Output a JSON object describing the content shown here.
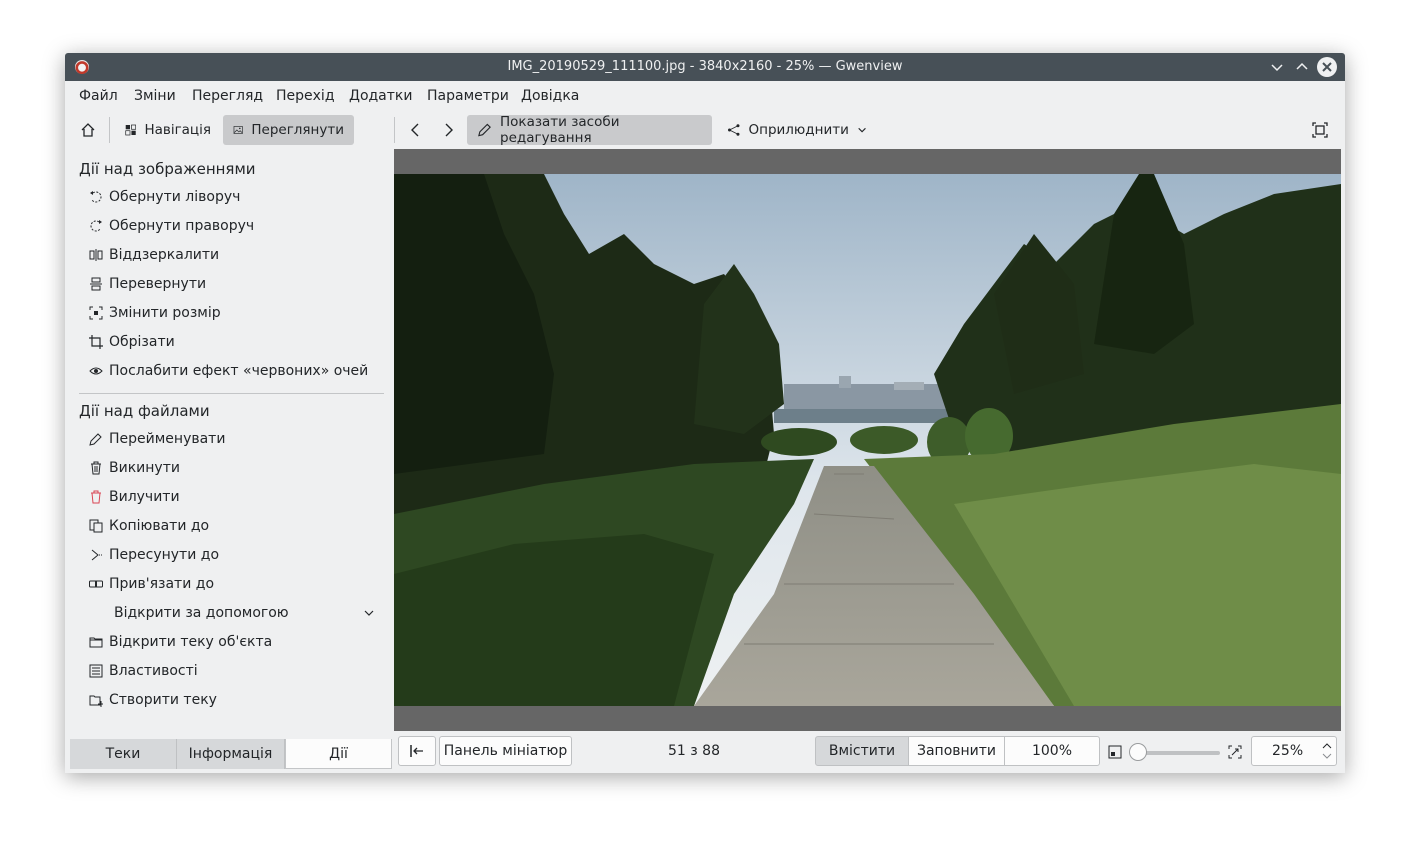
{
  "window": {
    "title": "IMG_20190529_111100.jpg - 3840x2160 - 25% — Gwenview"
  },
  "menu": [
    "Файл",
    "Зміни",
    "Перегляд",
    "Перехід",
    "Додатки",
    "Параметри",
    "Довідка"
  ],
  "toolbar": {
    "navigation": "Навігація",
    "view": "Переглянути",
    "edit_tools": "Показати засоби редагування",
    "share": "Оприлюднити"
  },
  "sidebar": {
    "image_actions_title": "Дії над зображеннями",
    "image_actions": [
      {
        "label": "Обернути ліворуч",
        "icon": "rotate-left-icon"
      },
      {
        "label": "Обернути праворуч",
        "icon": "rotate-right-icon"
      },
      {
        "label": "Віддзеркалити",
        "icon": "mirror-icon"
      },
      {
        "label": "Перевернути",
        "icon": "flip-icon"
      },
      {
        "label": "Змінити розмір",
        "icon": "resize-icon"
      },
      {
        "label": "Обрізати",
        "icon": "crop-icon"
      },
      {
        "label": "Послабити ефект «червоних» очей",
        "icon": "eye-icon"
      }
    ],
    "file_actions_title": "Дії над файлами",
    "file_actions": [
      {
        "label": "Перейменувати",
        "icon": "pencil-icon"
      },
      {
        "label": "Викинути",
        "icon": "trash-icon"
      },
      {
        "label": "Вилучити",
        "icon": "delete-icon"
      },
      {
        "label": "Копіювати до",
        "icon": "copy-icon"
      },
      {
        "label": "Пересунути до",
        "icon": "move-icon"
      },
      {
        "label": "Прив'язати до",
        "icon": "link-icon"
      },
      {
        "label": "Відкрити за допомогою",
        "icon": "chevron-down-icon"
      },
      {
        "label": "Відкрити теку об'єкта",
        "icon": "folder-icon"
      },
      {
        "label": "Властивості",
        "icon": "properties-icon"
      },
      {
        "label": "Створити теку",
        "icon": "new-folder-icon"
      }
    ],
    "tabs": [
      "Теки",
      "Інформація",
      "Дії"
    ],
    "active_tab": "Дії"
  },
  "statusbar": {
    "thumbnail_panel": "Панель мініатюр",
    "position": "51 з 88",
    "fit": "Вмістити",
    "fill": "Заповнити",
    "actual_size": "100%",
    "zoom_value": "25%",
    "zoom_slider_fraction": 0
  },
  "colors": {
    "titlebar": "#475057",
    "window_bg": "#eff0f1",
    "viewer_bg": "#666666",
    "active_button": "#c9cacc"
  }
}
